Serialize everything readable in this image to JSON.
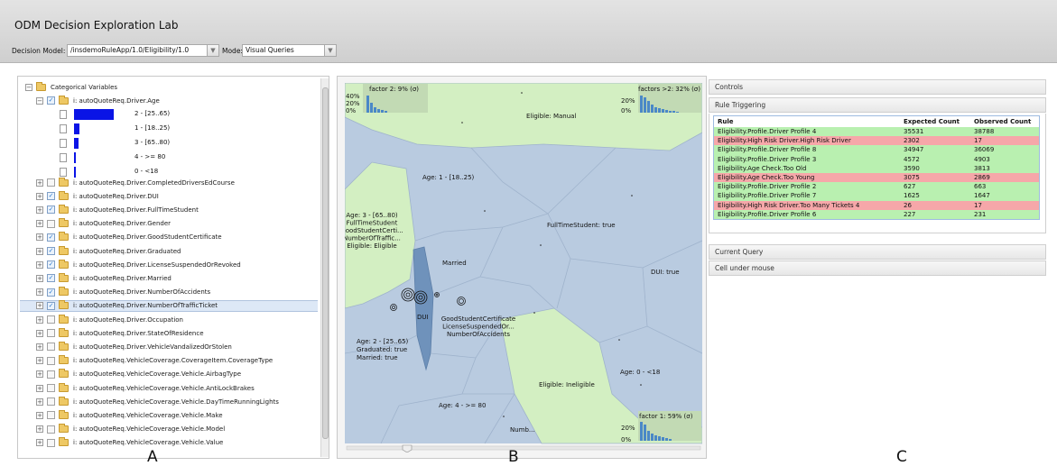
{
  "app": {
    "title": "ODM Decision Exploration Lab",
    "decision_model_label": "Decision Model:",
    "decision_model_value": "/insdemoRuleApp/1.0/Eligibility/1.0",
    "mode_label": "Mode:",
    "mode_value": "Visual Queries"
  },
  "tree": {
    "root": "Categorical Variables",
    "expanded_item": "i: autoQuoteReq.Driver.Age",
    "age_bins": [
      {
        "label": "2 - [25..65)",
        "value": 1.0
      },
      {
        "label": "1 - [18..25)",
        "value": 0.14
      },
      {
        "label": "3 - [65..80)",
        "value": 0.12
      },
      {
        "label": "4 - >= 80",
        "value": 0.04
      },
      {
        "label": "0 - <18",
        "value": 0.03
      }
    ],
    "items": [
      {
        "label": "i: autoQuoteReq.Driver.CompletedDriversEdCourse",
        "checked": false
      },
      {
        "label": "i: autoQuoteReq.Driver.DUI",
        "checked": true
      },
      {
        "label": "i: autoQuoteReq.Driver.FullTimeStudent",
        "checked": true
      },
      {
        "label": "i: autoQuoteReq.Driver.Gender",
        "checked": false
      },
      {
        "label": "i: autoQuoteReq.Driver.GoodStudentCertificate",
        "checked": true
      },
      {
        "label": "i: autoQuoteReq.Driver.Graduated",
        "checked": true
      },
      {
        "label": "i: autoQuoteReq.Driver.LicenseSuspendedOrRevoked",
        "checked": true
      },
      {
        "label": "i: autoQuoteReq.Driver.Married",
        "checked": true
      },
      {
        "label": "i: autoQuoteReq.Driver.NumberOfAccidents",
        "checked": true
      },
      {
        "label": "i: autoQuoteReq.Driver.NumberOfTrafficTicket",
        "checked": true
      },
      {
        "label": "i: autoQuoteReq.Driver.Occupation",
        "checked": false
      },
      {
        "label": "i: autoQuoteReq.Driver.StateOfResidence",
        "checked": false
      },
      {
        "label": "i: autoQuoteReq.Driver.VehicleVandalizedOrStolen",
        "checked": false
      },
      {
        "label": "i: autoQuoteReq.VehicleCoverage.CoverageItem.CoverageType",
        "checked": false
      },
      {
        "label": "i: autoQuoteReq.VehicleCoverage.Vehicle.AirbagType",
        "checked": false
      },
      {
        "label": "i: autoQuoteReq.VehicleCoverage.Vehicle.AntiLockBrakes",
        "checked": false
      },
      {
        "label": "i: autoQuoteReq.VehicleCoverage.Vehicle.DayTimeRunningLights",
        "checked": false
      },
      {
        "label": "i: autoQuoteReq.VehicleCoverage.Vehicle.Make",
        "checked": false
      },
      {
        "label": "i: autoQuoteReq.VehicleCoverage.Vehicle.Model",
        "checked": false
      },
      {
        "label": "i: autoQuoteReq.VehicleCoverage.Vehicle.Value",
        "checked": false
      }
    ],
    "selected_index": 9
  },
  "viz": {
    "factor2_label": "factor 2: 9% (σ)",
    "factor2_ticks": [
      "40%",
      "20%",
      "0%"
    ],
    "factor_gt2_label": "factors >2: 32% (σ)",
    "factor_gt2_ticks": [
      "20%",
      "0%"
    ],
    "factor1_label": "factor 1: 59% (σ)",
    "factor1_ticks": [
      "20%",
      "0%"
    ],
    "eligible_manual": "Eligible: Manual",
    "age_1": "Age: 1 - [18..25)",
    "age_3_lines": [
      "Age: 3 - [65..80)",
      "FullTimeStudent",
      "GoodStudentCerti...",
      "NumberOfTraffic...",
      "Eligible: Eligible"
    ],
    "fulltime_true": "FullTimeStudent: true",
    "married": "Married",
    "dui_true": "DUI: true",
    "dui": "DUI",
    "good_lines": [
      "GoodStudentCertificate",
      "LicenseSuspendedOr...",
      "NumberOfAccidents"
    ],
    "age_2_lines": [
      "Age: 2 - [25..65)",
      "Graduated: true",
      "Married: true"
    ],
    "age_0": "Age: 0 - <18",
    "eligible_ineligible": "Eligible: Ineligible",
    "age_4": "Age: 4 - >= 80",
    "numb": "Numb...",
    "colors": {
      "green": "#d3efc2",
      "blue": "#b9cbe0",
      "dark_blue": "#6f92bb",
      "bars": "#4a88c7"
    }
  },
  "controls": {
    "controls_header": "Controls",
    "rule_triggering_header": "Rule Triggering",
    "current_query_header": "Current Query",
    "cell_under_mouse_header": "Cell under mouse",
    "columns": [
      "Rule",
      "Expected Count",
      "Observed Count"
    ],
    "rows": [
      {
        "rule": "Eligibility.Profile.Driver Profile 4",
        "expected": "35531",
        "observed": "38788",
        "status": "ok"
      },
      {
        "rule": "Eligibility.High Risk Driver.High Risk Driver",
        "expected": "2302",
        "observed": "17",
        "status": "bad"
      },
      {
        "rule": "Eligibility.Profile.Driver Profile 8",
        "expected": "34947",
        "observed": "36069",
        "status": "ok"
      },
      {
        "rule": "Eligibility.Profile.Driver Profile 3",
        "expected": "4572",
        "observed": "4903",
        "status": "ok"
      },
      {
        "rule": "Eligibility.Age Check.Too Old",
        "expected": "3590",
        "observed": "3813",
        "status": "ok"
      },
      {
        "rule": "Eligibility.Age Check.Too Young",
        "expected": "3075",
        "observed": "2869",
        "status": "bad"
      },
      {
        "rule": "Eligibility.Profile.Driver Profile 2",
        "expected": "627",
        "observed": "663",
        "status": "ok"
      },
      {
        "rule": "Eligibility.Profile.Driver Profile 7",
        "expected": "1625",
        "observed": "1647",
        "status": "ok"
      },
      {
        "rule": "Eligibility.High Risk Driver.Too Many Tickets 4",
        "expected": "26",
        "observed": "17",
        "status": "bad"
      },
      {
        "rule": "Eligibility.Profile.Driver Profile 6",
        "expected": "227",
        "observed": "231",
        "status": "ok"
      }
    ]
  },
  "figure_letters": [
    "A",
    "B",
    "C"
  ]
}
